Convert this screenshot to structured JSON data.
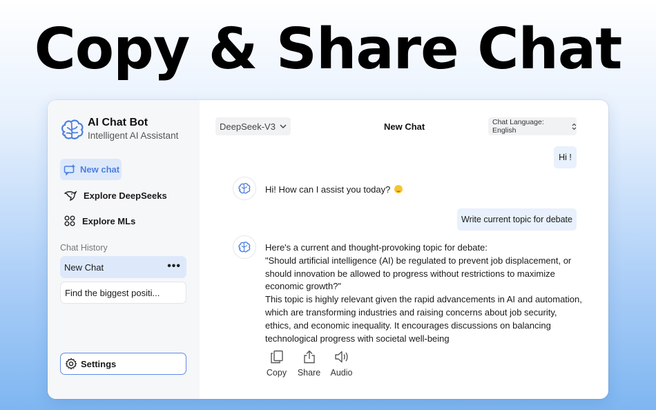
{
  "headline": "Copy & Share Chat",
  "app": {
    "title": "AI Chat Bot",
    "subtitle": "Intelligent AI Assistant"
  },
  "sidebar": {
    "new_chat": "New chat",
    "nav": [
      {
        "label": "Explore DeepSeeks",
        "icon": "dolphin-icon"
      },
      {
        "label": "Explore MLs",
        "icon": "grid-icon"
      }
    ],
    "history_title": "Chat History",
    "history": [
      {
        "label": "New Chat",
        "active": true
      },
      {
        "label": "Find the biggest positi..."
      }
    ],
    "settings": "Settings"
  },
  "header": {
    "model": "DeepSeek-V3",
    "chat_title": "New Chat",
    "language": "Chat Language: English"
  },
  "messages": {
    "user_1": "Hi !",
    "bot_1": "Hi! How can I assist you today?",
    "user_2": "Write current topic for debate",
    "bot_2": "Here's a current and thought-provoking topic for debate:\n\"Should artificial intelligence (AI) be regulated to prevent job displacement, or should innovation be allowed to progress without restrictions to maximize economic growth?\"\nThis topic is highly relevant given the rapid advancements in AI and automation, which are transforming industries and raising concerns about job security, ethics, and economic inequality. It encourages discussions on balancing technological progress with societal well-being"
  },
  "actions": {
    "copy": "Copy",
    "share": "Share",
    "audio": "Audio"
  },
  "colors": {
    "accent": "#4d7fe0",
    "selected_bg": "#dde9fb",
    "user_bubble": "#e8f1fc"
  }
}
